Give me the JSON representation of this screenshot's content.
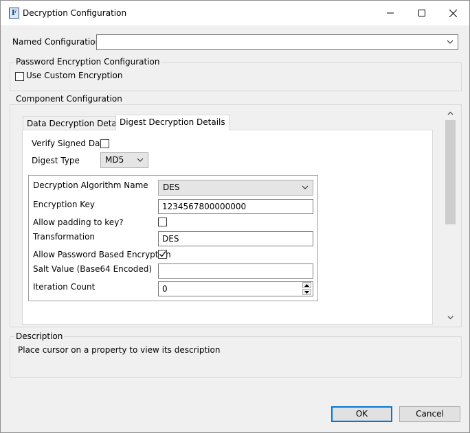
{
  "window": {
    "title": "Decryption Configuration",
    "icon_letter": "F",
    "minimize_icon": "minimize-icon",
    "maximize_icon": "maximize-icon",
    "close_icon": "close-icon"
  },
  "named_configuration": {
    "label": "Named Configuration",
    "value": ""
  },
  "password_encryption": {
    "group_title": "Password Encryption Configuration",
    "use_custom_label": "Use Custom Encryption",
    "use_custom_checked": false
  },
  "component_configuration": {
    "group_title": "Component Configuration",
    "tabs": [
      {
        "label": "Data Decryption Details",
        "active": false
      },
      {
        "label": "Digest Decryption Details",
        "active": true
      }
    ],
    "verify_signed_label": "Verify Signed Data",
    "verify_signed_checked": false,
    "digest_type_label": "Digest Type",
    "digest_type_value": "MD5",
    "fields": {
      "algorithm_label": "Decryption Algorithm Name",
      "algorithm_value": "DES",
      "encryption_key_label": "Encryption Key",
      "encryption_key_value": "1234567800000000",
      "allow_padding_label": "Allow padding to key?",
      "allow_padding_checked": false,
      "transformation_label": "Transformation",
      "transformation_value": "DES",
      "allow_pbe_label": "Allow Password Based Encryption",
      "allow_pbe_checked": true,
      "salt_label": "Salt Value (Base64 Encoded)",
      "salt_value": "",
      "iteration_label": "Iteration Count",
      "iteration_value": "0"
    }
  },
  "description": {
    "group_title": "Description",
    "text": "Place cursor on a property to view its description"
  },
  "buttons": {
    "ok": "OK",
    "cancel": "Cancel"
  },
  "colors": {
    "accent": "#0078d7",
    "dialog_bg": "#f0f0f0"
  }
}
